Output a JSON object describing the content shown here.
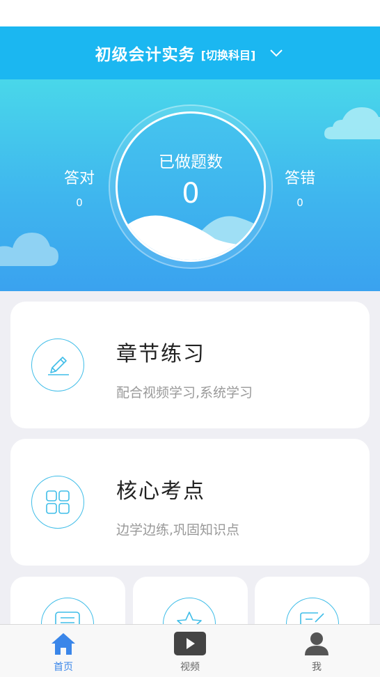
{
  "header": {
    "title": "初级会计实务",
    "switch_label": "[切换科目]"
  },
  "stats": {
    "correct_label": "答对",
    "correct_value": "0",
    "wrong_label": "答错",
    "wrong_value": "0",
    "done_label": "已做题数",
    "done_value": "0"
  },
  "cards": [
    {
      "title": "章节练习",
      "subtitle": "配合视频学习,系统学习",
      "icon": "pencil-icon"
    },
    {
      "title": "核心考点",
      "subtitle": "边学边练,巩固知识点",
      "icon": "grid-icon"
    }
  ],
  "small_cards": [
    {
      "icon": "document-icon"
    },
    {
      "icon": "star-icon"
    },
    {
      "icon": "edit-icon"
    }
  ],
  "tabbar": {
    "items": [
      {
        "label": "首页",
        "icon": "home-icon",
        "active": true
      },
      {
        "label": "视频",
        "icon": "video-icon",
        "active": false
      },
      {
        "label": "我",
        "icon": "user-icon",
        "active": false
      }
    ]
  },
  "colors": {
    "accent": "#1bb7f1",
    "icon_stroke": "#3fbde8",
    "tab_active": "#3a86e9",
    "tab_inactive": "#666666"
  }
}
